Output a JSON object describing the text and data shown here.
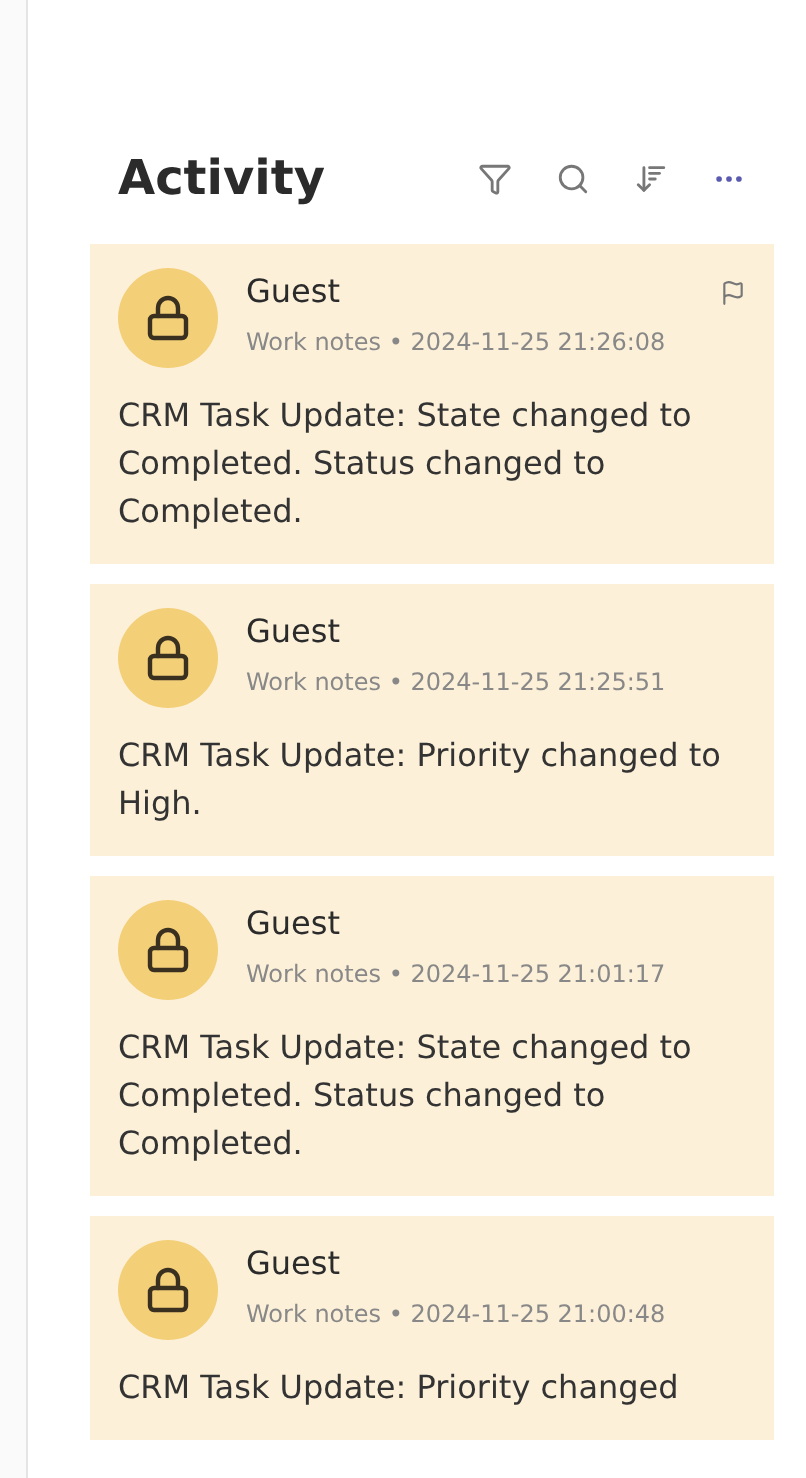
{
  "header": {
    "title": "Activity"
  },
  "entries": [
    {
      "author": "Guest",
      "source": "Work notes",
      "separator": "•",
      "timestamp": "2024-11-25 21:26:08",
      "flagged": true,
      "text": "CRM Task Update: State changed to Completed. Status changed to Completed."
    },
    {
      "author": "Guest",
      "source": "Work notes",
      "separator": "•",
      "timestamp": "2024-11-25 21:25:51",
      "flagged": false,
      "text": "CRM Task Update: Priority changed to High."
    },
    {
      "author": "Guest",
      "source": "Work notes",
      "separator": "•",
      "timestamp": "2024-11-25 21:01:17",
      "flagged": false,
      "text": "CRM Task Update: State changed to Completed. Status changed to Completed."
    },
    {
      "author": "Guest",
      "source": "Work notes",
      "separator": "•",
      "timestamp": "2024-11-25 21:00:48",
      "flagged": false,
      "text": "CRM Task Update: Priority changed"
    }
  ]
}
